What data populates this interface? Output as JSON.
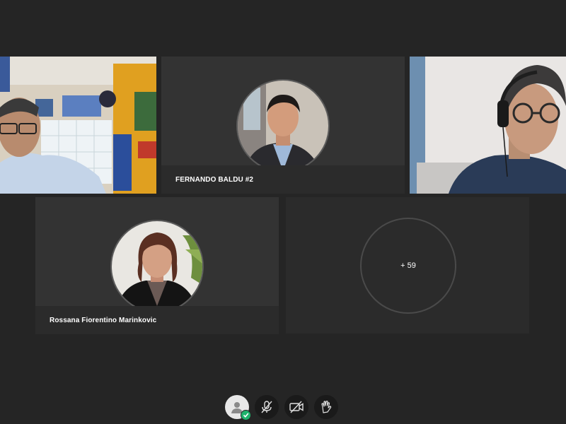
{
  "participants": {
    "video_left": {
      "name": ""
    },
    "fernando": {
      "name": "FERNANDO BALDU #2"
    },
    "video_right": {
      "name": ""
    },
    "rossana": {
      "name": "Rossana Fiorentino Marinkovic"
    },
    "more": {
      "label": "+ 59"
    }
  },
  "toolbar": {
    "buttons": [
      "user-status",
      "mute-microphone",
      "stop-camera",
      "raise-hand"
    ]
  },
  "colors": {
    "background": "#252525",
    "tile": "#333333",
    "name_bar": "#2b2b2b",
    "status_green": "#1fb26b"
  }
}
